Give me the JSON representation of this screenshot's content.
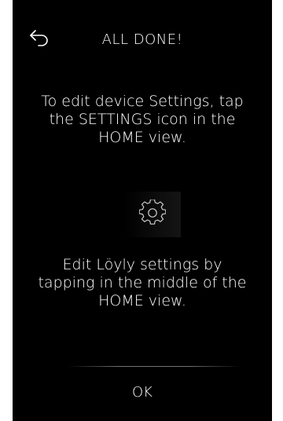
{
  "header": {
    "title": "ALL DONE!",
    "back_icon": "back-arrow-icon"
  },
  "content": {
    "instruction_settings": "To edit device Settings, tap the SETTINGS icon in the HOME view.",
    "settings_icon": "gear-icon",
    "instruction_loyly": "Edit Löyly settings by tapping in the middle of the HOME view."
  },
  "footer": {
    "ok_label": "OK"
  },
  "colors": {
    "background": "#000000",
    "text": "#ffffff"
  }
}
